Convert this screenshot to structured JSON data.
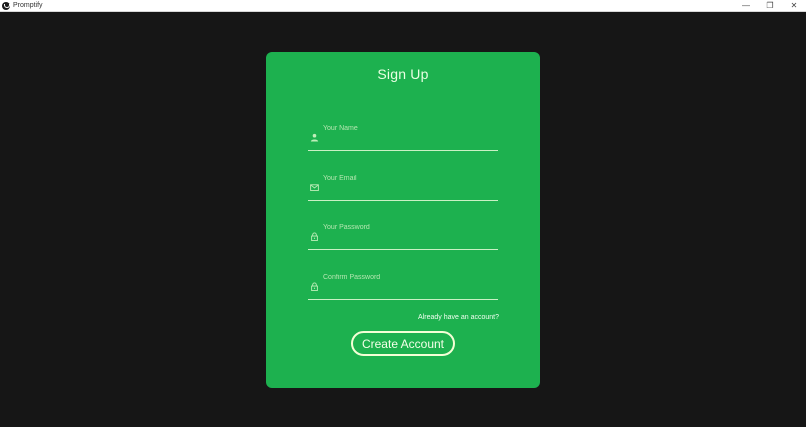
{
  "window": {
    "title": "Promptify",
    "controls": {
      "minimize": "—",
      "maximize": "❐",
      "close": "✕"
    }
  },
  "signup": {
    "title": "Sign Up",
    "fields": [
      {
        "icon": "user-icon",
        "placeholder": "Your Name",
        "value": ""
      },
      {
        "icon": "mail-icon",
        "placeholder": "Your Email",
        "value": ""
      },
      {
        "icon": "lock-icon",
        "placeholder": "Your Password",
        "value": ""
      },
      {
        "icon": "lock-icon",
        "placeholder": "Confirm Password",
        "value": ""
      }
    ],
    "login_link": "Already have an account?",
    "submit_label": "Create Account"
  },
  "colors": {
    "background": "#161616",
    "card": "#1db14f",
    "accent_text": "#e9ffe3"
  }
}
